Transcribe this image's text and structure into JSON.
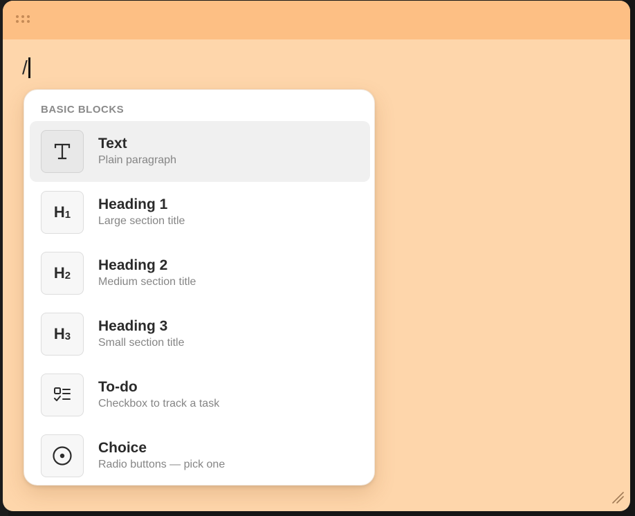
{
  "editor": {
    "typed_text": "/"
  },
  "menu": {
    "section_label": "BASIC BLOCKS",
    "items": [
      {
        "title": "Text",
        "description": "Plain paragraph",
        "icon": "text-icon",
        "selected": true
      },
      {
        "title": "Heading 1",
        "description": "Large section title",
        "icon": "heading-1-icon",
        "icon_glyph": "H",
        "icon_sub": "1"
      },
      {
        "title": "Heading 2",
        "description": "Medium section title",
        "icon": "heading-2-icon",
        "icon_glyph": "H",
        "icon_sub": "2"
      },
      {
        "title": "Heading 3",
        "description": "Small section title",
        "icon": "heading-3-icon",
        "icon_glyph": "H",
        "icon_sub": "3"
      },
      {
        "title": "To-do",
        "description": "Checkbox to track a task",
        "icon": "todo-checklist-icon"
      },
      {
        "title": "Choice",
        "description": "Radio buttons — pick one",
        "icon": "radio-button-icon"
      }
    ]
  },
  "colors": {
    "window_background": "#fed6ab",
    "titlebar_background": "#fdbf84",
    "menu_background": "#ffffff",
    "selected_item_background": "#f0f0f0"
  }
}
